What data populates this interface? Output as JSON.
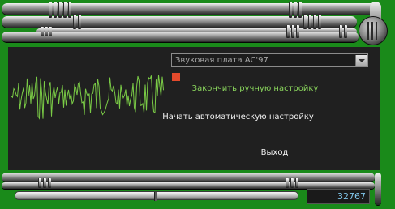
{
  "app": {
    "device_select": {
      "value": "Звуковая плата AC'97"
    },
    "actions": {
      "finish_manual": "Закончить ручную настройку",
      "start_auto": "Начать автоматическую настройку",
      "exit": "Выход"
    },
    "indicator_color": "#e44a2c",
    "value_display": "32767",
    "slider_level": 0.49
  },
  "icons": [
    "dropdown-arrow-icon",
    "waveform-icon",
    "knob-icon"
  ],
  "colors": {
    "frame_green": "#1a8a1a",
    "panel": "#202020",
    "wave": "#7acb46",
    "accent_text": "#89d45c"
  }
}
